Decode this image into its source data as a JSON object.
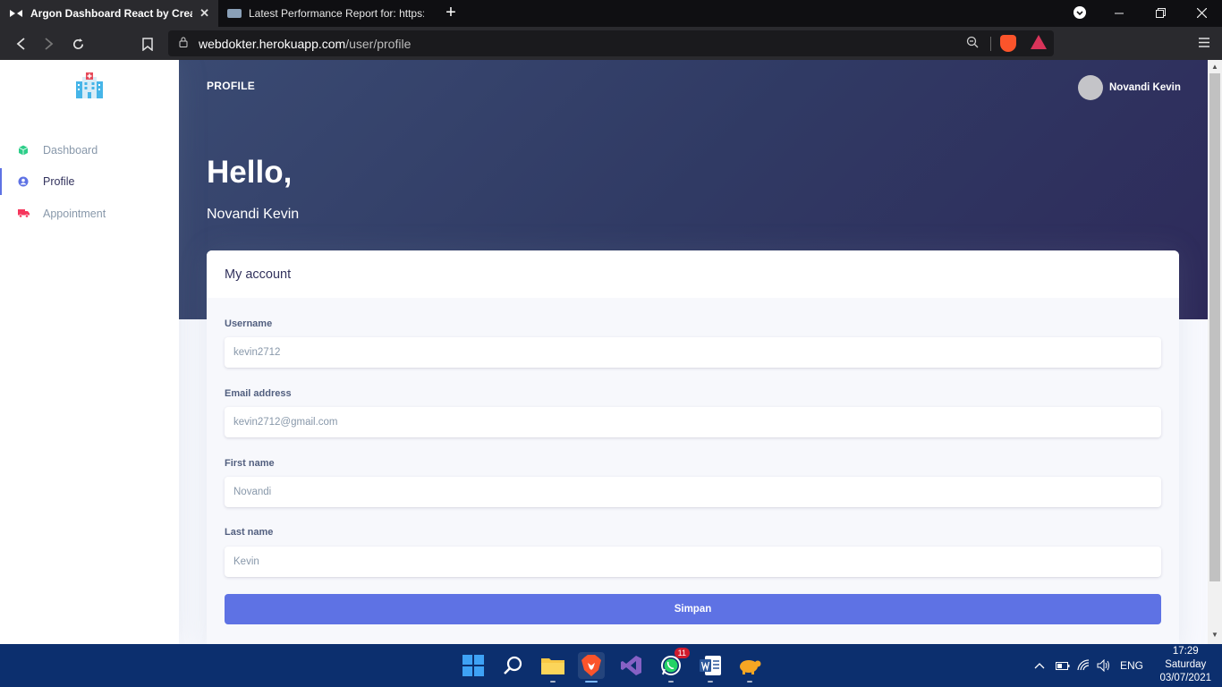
{
  "browser": {
    "tabs": [
      {
        "title": "Argon Dashboard React by Creati",
        "active": true
      },
      {
        "title": "Latest Performance Report for: https:/",
        "active": false
      }
    ],
    "url_host": "webdokter.herokuapp.com",
    "url_path": "/user/profile",
    "close_glyph": "✕",
    "newtab_glyph": "+"
  },
  "header": {
    "brand": "PROFILE",
    "user_name": "Novandi Kevin",
    "hello": "Hello,",
    "full_name": "Novandi Kevin"
  },
  "sidebar": {
    "items": [
      {
        "label": "Dashboard",
        "icon": "cube-icon",
        "color": "#2dce89"
      },
      {
        "label": "Profile",
        "icon": "user-icon",
        "color": "#5e72e4"
      },
      {
        "label": "Appointment",
        "icon": "truck-icon",
        "color": "#f5365c"
      }
    ]
  },
  "card": {
    "title": "My account",
    "fields": [
      {
        "label": "Username",
        "value": "kevin2712"
      },
      {
        "label": "Email address",
        "value": "kevin2712@gmail.com"
      },
      {
        "label": "First name",
        "value": "Novandi"
      },
      {
        "label": "Last name",
        "value": "Kevin"
      }
    ],
    "submit_label": "Simpan"
  },
  "taskbar": {
    "whatsapp_badge": "11",
    "lang": "ENG",
    "time": "17:29",
    "day": "Saturday",
    "date": "03/07/2021"
  },
  "colors": {
    "accent": "#5e72e4",
    "header": "#303a64",
    "taskbar": "#0c2f6e"
  }
}
